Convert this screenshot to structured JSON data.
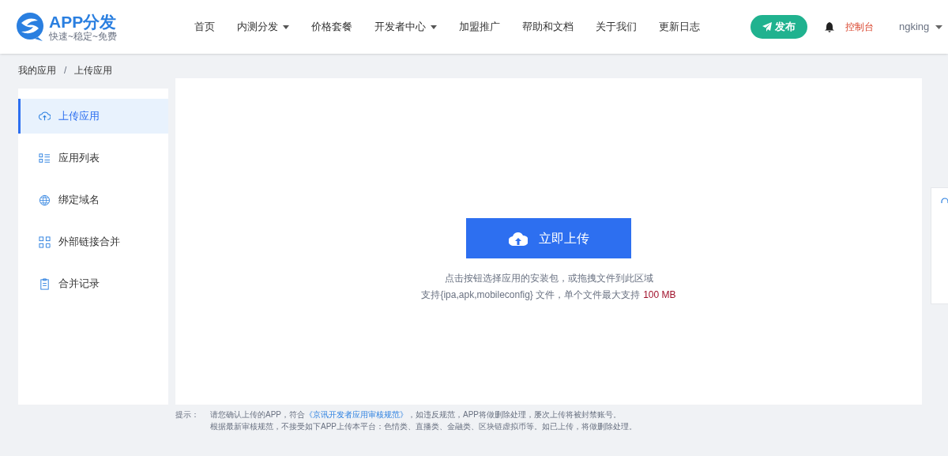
{
  "header": {
    "logo": {
      "title": "APP分发",
      "slogan": "快速~稳定~免费"
    },
    "nav": [
      {
        "label": "首页",
        "dropdown": false
      },
      {
        "label": "内测分发",
        "dropdown": true
      },
      {
        "label": "价格套餐",
        "dropdown": false
      },
      {
        "label": "开发者中心",
        "dropdown": true
      },
      {
        "label": "加盟推广",
        "dropdown": false
      },
      {
        "label": "帮助和文档",
        "dropdown": false
      },
      {
        "label": "关于我们",
        "dropdown": false
      },
      {
        "label": "更新日志",
        "dropdown": false
      }
    ],
    "publish_button": "发布",
    "console_link": "控制台",
    "user": "ngking"
  },
  "breadcrumb": {
    "items": [
      "我的应用",
      "上传应用"
    ],
    "separator": "/"
  },
  "sidebar": {
    "items": [
      {
        "label": "上传应用",
        "kind": "upload",
        "selected": true
      },
      {
        "label": "应用列表",
        "kind": "list",
        "selected": false
      },
      {
        "label": "绑定域名",
        "kind": "domain",
        "selected": false
      },
      {
        "label": "外部链接合并",
        "kind": "merge",
        "selected": false
      },
      {
        "label": "合并记录",
        "kind": "record",
        "selected": false
      }
    ]
  },
  "upload": {
    "button": "立即上传",
    "hint": "点击按钮选择应用的安装包，或拖拽文件到此区域",
    "formats": "支持{ipa,apk,mobileconfig} 文件，单个文件最大支持",
    "max_size": "100 MB"
  },
  "notice": {
    "label": "提示：",
    "line1": {
      "before": "请您确认上传的APP，符合",
      "link": "《京讯开发者应用审核规范》",
      "after": "，如违反规范，APP将做删除处理，屡次上传将被封禁账号。"
    },
    "line2": "根据最新审核规范，不接受如下APP上传本平台：色情类、直播类、金融类、区块链虚拟币等。如已上传，将做删除处理。"
  }
}
